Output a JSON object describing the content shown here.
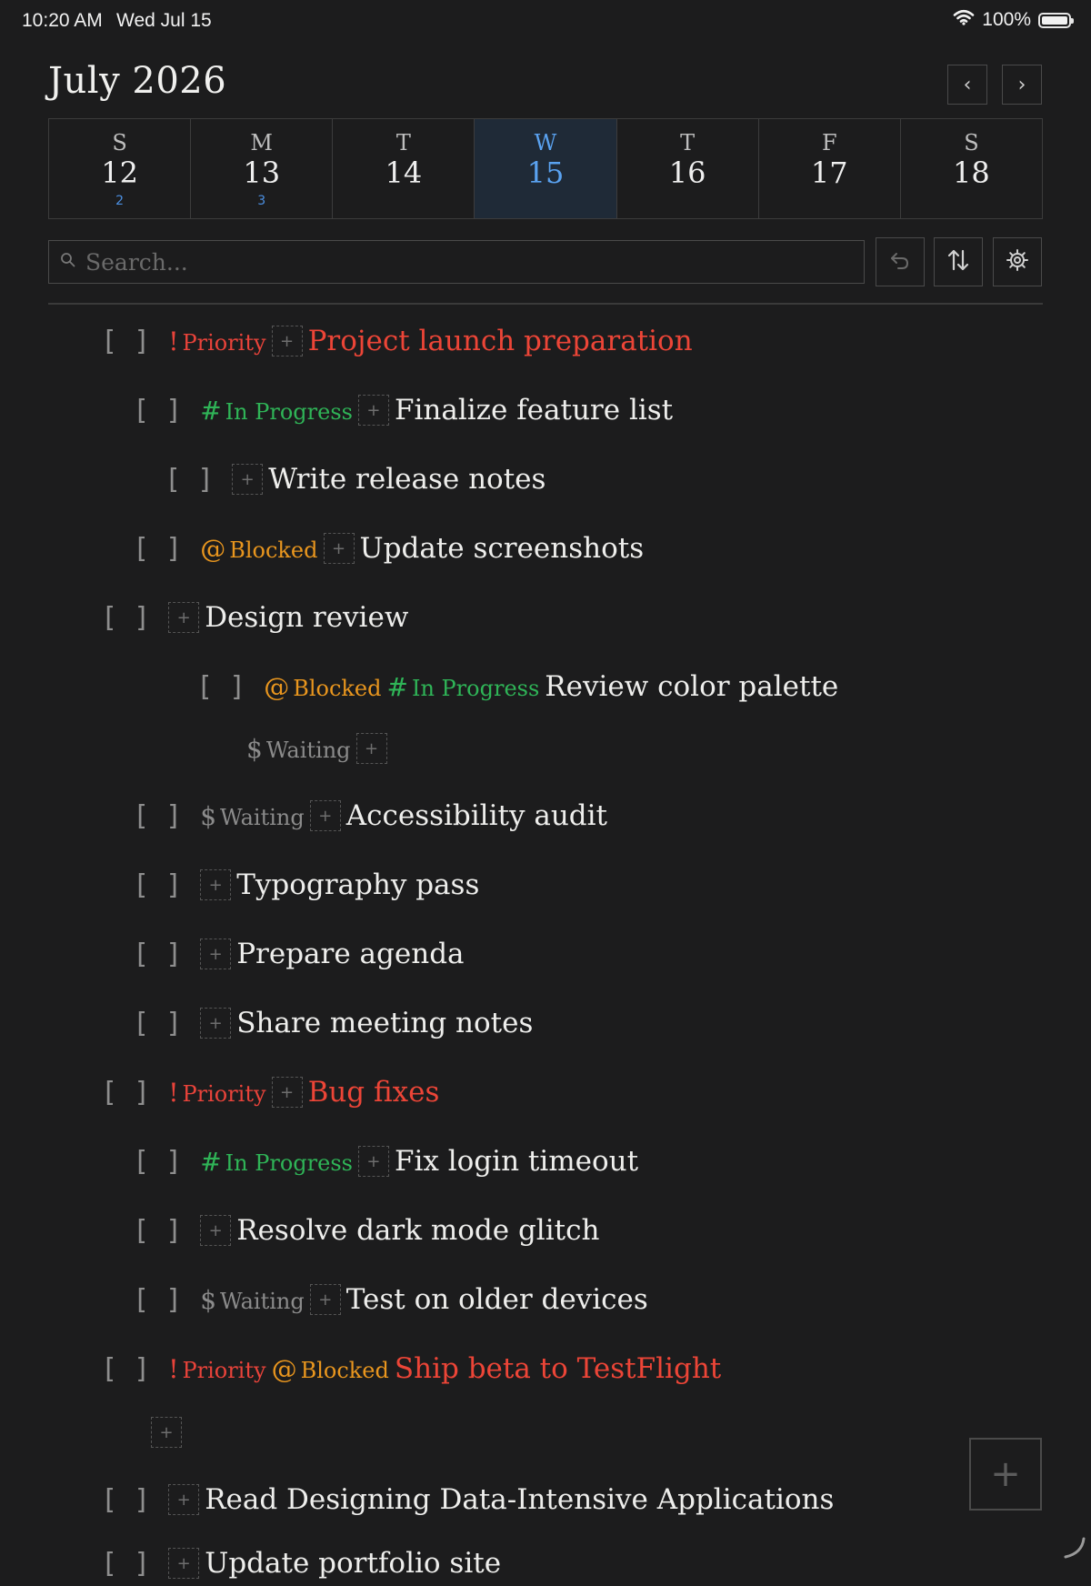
{
  "status": {
    "time": "10:20 AM",
    "date": "Wed Jul 15",
    "battery": "100%"
  },
  "header": {
    "month": "July 2026",
    "prev_label": "‹",
    "next_label": "›"
  },
  "week": [
    {
      "name": "S",
      "date": "12",
      "count": "2",
      "selected": false
    },
    {
      "name": "M",
      "date": "13",
      "count": "3",
      "selected": false
    },
    {
      "name": "T",
      "date": "14",
      "count": "",
      "selected": false
    },
    {
      "name": "W",
      "date": "15",
      "count": "",
      "selected": true
    },
    {
      "name": "T",
      "date": "16",
      "count": "",
      "selected": false
    },
    {
      "name": "F",
      "date": "17",
      "count": "",
      "selected": false
    },
    {
      "name": "S",
      "date": "18",
      "count": "",
      "selected": false
    }
  ],
  "search": {
    "placeholder": "Search...",
    "value": ""
  },
  "toolbar": {
    "undo_icon": "undo-icon",
    "sort_icon": "sort-icon",
    "settings_icon": "gear-icon"
  },
  "tags": {
    "priority": {
      "symbol": "!",
      "label": "Priority",
      "color": "#e8433a"
    },
    "in_progress": {
      "symbol": "#",
      "label": "In Progress",
      "color": "#2fb457"
    },
    "blocked": {
      "symbol": "@",
      "label": "Blocked",
      "color": "#e9961e"
    },
    "waiting": {
      "symbol": "$",
      "label": "Waiting",
      "color": "#8b8b8b"
    }
  },
  "checkbox_label": "[ ]",
  "add_label": "+",
  "tasks": [
    {
      "title": "Project launch preparation",
      "tags": [
        "priority"
      ],
      "checkbox": true,
      "add": true,
      "red": true
    },
    {
      "title": "Finalize feature list",
      "tags": [
        "in_progress"
      ],
      "checkbox": true,
      "add": true,
      "red": false
    },
    {
      "title": "Write release notes",
      "tags": [],
      "checkbox": true,
      "add": true,
      "red": false
    },
    {
      "title": "Update screenshots",
      "tags": [
        "blocked"
      ],
      "checkbox": true,
      "add": true,
      "red": false
    },
    {
      "title": "Design review",
      "tags": [],
      "checkbox": true,
      "add": true,
      "red": false
    },
    {
      "title": "Review color palette",
      "tags": [
        "blocked",
        "in_progress"
      ],
      "checkbox": true,
      "add": false,
      "red": false
    },
    {
      "title": "",
      "tags": [
        "waiting"
      ],
      "checkbox": false,
      "add": true,
      "red": false
    },
    {
      "title": "Accessibility audit",
      "tags": [
        "waiting"
      ],
      "checkbox": true,
      "add": true,
      "red": false
    },
    {
      "title": "Typography pass",
      "tags": [],
      "checkbox": true,
      "add": true,
      "red": false
    },
    {
      "title": "Prepare agenda",
      "tags": [],
      "checkbox": true,
      "add": true,
      "red": false
    },
    {
      "title": "Share meeting notes",
      "tags": [],
      "checkbox": true,
      "add": true,
      "red": false
    },
    {
      "title": "Bug fixes",
      "tags": [
        "priority"
      ],
      "checkbox": true,
      "add": true,
      "red": true
    },
    {
      "title": "Fix login timeout",
      "tags": [
        "in_progress"
      ],
      "checkbox": true,
      "add": true,
      "red": false
    },
    {
      "title": "Resolve dark mode glitch",
      "tags": [],
      "checkbox": true,
      "add": true,
      "red": false
    },
    {
      "title": "Test on older devices",
      "tags": [
        "waiting"
      ],
      "checkbox": true,
      "add": true,
      "red": false
    },
    {
      "title": "Ship beta to TestFlight",
      "tags": [
        "priority",
        "blocked"
      ],
      "checkbox": true,
      "add": false,
      "red": true
    },
    {
      "title": "",
      "tags": [],
      "checkbox": false,
      "add": true,
      "red": false
    },
    {
      "title": "Read Designing Data-Intensive Applications",
      "tags": [],
      "checkbox": true,
      "add": true,
      "red": false
    },
    {
      "title": "Update portfolio site",
      "tags": [],
      "checkbox": true,
      "add": true,
      "red": false
    }
  ],
  "fab_label": "+"
}
